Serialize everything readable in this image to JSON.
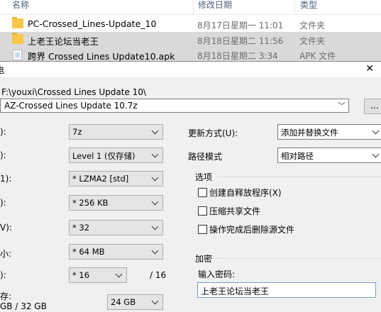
{
  "explorer": {
    "columns": {
      "name": "名称",
      "date": "修改日期",
      "type": "类型"
    },
    "rows": [
      {
        "name": "PC-Crossed_Lines-Update_10",
        "date": "8月17日星期一 11:01",
        "type": "文件夹",
        "icon": "folder-icon"
      },
      {
        "name": "上老王论坛当老王",
        "date": "8月18日星期二 11:56",
        "type": "文件夹",
        "icon": "folder-icon"
      },
      {
        "name": "跨界 Crossed Lines Update10.apk",
        "date": "8月18日星期二 3:34",
        "type": "APK 文件",
        "icon": "apk-file-icon"
      }
    ]
  },
  "dialog": {
    "title": "电",
    "close": "✕",
    "path": "F:\\youxi\\Crossed Lines Update 10\\",
    "archive_name": "AZ-Crossed Lines Update 10.7z",
    "browse_label": "...",
    "left_labels": {
      "format": "):",
      "level": "):",
      "method": "1):",
      "dict": "):",
      "word": "V):",
      "solid": "小:",
      "threads": "):",
      "memory": "存:",
      "memory_usage": "GB / 32 GB"
    },
    "format_value": "7z",
    "level_value": "Level 1 (仅存储)",
    "method_value": "* LZMA2 [std]",
    "dict_value": "* 256 KB",
    "word_value": "* 32",
    "solid_value": "* 64 MB",
    "threads_value": "* 16",
    "threads_total": "/ 16",
    "memory_value": "24 GB",
    "update_mode_label": "更新方式(U):",
    "update_mode_value": "添加并替换文件",
    "path_mode_label": "路径模式",
    "path_mode_value": "相对路径",
    "options_group": "选项",
    "options": [
      {
        "label": "创建自释放程序(X)",
        "checked": false
      },
      {
        "label": "压缩共享文件",
        "checked": false
      },
      {
        "label": "操作完成后删除源文件",
        "checked": false
      }
    ],
    "encryption_group": "加密",
    "password_label": "输入密码:",
    "password_value": "上老王论坛当老王"
  }
}
